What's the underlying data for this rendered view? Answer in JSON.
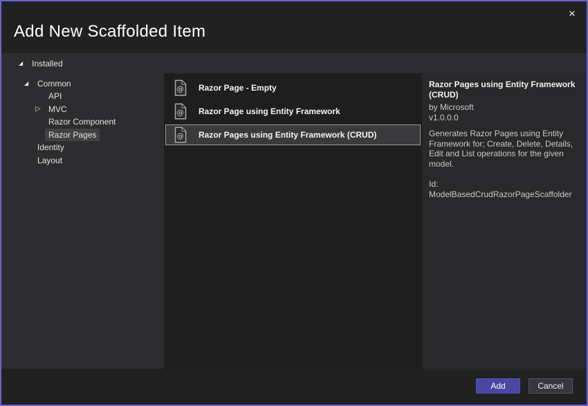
{
  "window": {
    "title": "Add New Scaffolded Item",
    "close_glyph": "×"
  },
  "tree": {
    "glyphs": {
      "expanded": "◢",
      "collapsed": "▷"
    },
    "items": [
      {
        "label": "Installed",
        "level": 0,
        "state": "expanded",
        "selected": false
      },
      {
        "label": "Common",
        "level": 1,
        "state": "expanded",
        "selected": false
      },
      {
        "label": "API",
        "level": 2,
        "state": "leaf",
        "selected": false
      },
      {
        "label": "MVC",
        "level": 2,
        "state": "collapsed",
        "selected": false
      },
      {
        "label": "Razor Component",
        "level": 2,
        "state": "leaf",
        "selected": false
      },
      {
        "label": "Razor Pages",
        "level": 2,
        "state": "leaf",
        "selected": true
      },
      {
        "label": "Identity",
        "level": 1,
        "state": "leaf",
        "selected": false
      },
      {
        "label": "Layout",
        "level": 1,
        "state": "leaf",
        "selected": false
      }
    ]
  },
  "list": {
    "icon_name": "razor-page-icon",
    "icon_glyph": "@",
    "items": [
      {
        "label": "Razor Page - Empty",
        "selected": false
      },
      {
        "label": "Razor Page using Entity Framework",
        "selected": false
      },
      {
        "label": "Razor Pages using Entity Framework (CRUD)",
        "selected": true
      }
    ]
  },
  "details": {
    "title": "Razor Pages using Entity Framework (CRUD)",
    "author": "by Microsoft",
    "version": "v1.0.0.0",
    "description": "Generates Razor Pages using Entity Framework for; Create, Delete, Details, Edit and List operations for the given model.",
    "id": "Id: ModelBasedCrudRazorPageScaffolder"
  },
  "footer": {
    "add_label": "Add",
    "cancel_label": "Cancel"
  },
  "colors": {
    "window_border": "#6A63D0",
    "titlebar_bg": "#212122",
    "dialog_bg": "#2D2D30",
    "list_panel_bg": "#1E1E1F",
    "detail_panel_bg": "#29292B",
    "selected_row_bg": "#3A3A3D",
    "selected_row_border": "#9E9E9E",
    "add_button_bg": "#4A47A3",
    "cancel_button_bg": "#37373B",
    "text_primary": "#F2F2F2",
    "text_secondary": "#C9C9C9"
  }
}
